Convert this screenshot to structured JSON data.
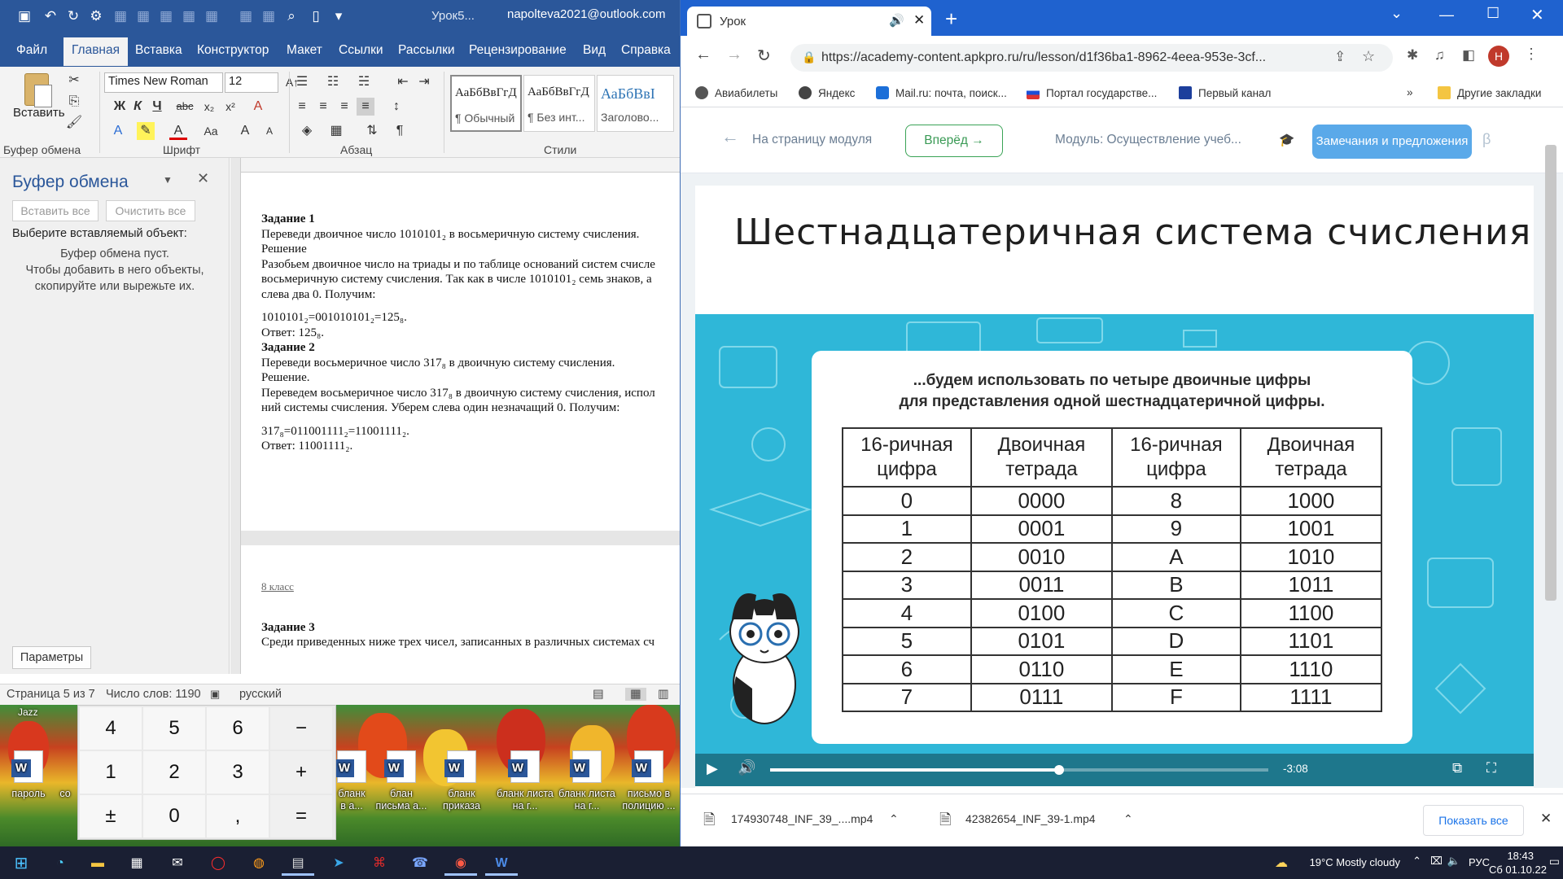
{
  "word": {
    "doc_title": "Урок5...",
    "account": "napolteva2021@outlook.com",
    "tabs": [
      "Файл",
      "Главная",
      "Вставка",
      "Конструктор",
      "Макет",
      "Ссылки",
      "Рассылки",
      "Рецензирование",
      "Вид",
      "Справка"
    ],
    "ribbon": {
      "paste_label": "Вставить",
      "font_name": "Times New Roman",
      "font_size": "12",
      "styles": [
        {
          "preview": "АаБбВвГгД",
          "name": "¶ Обычный"
        },
        {
          "preview": "АаБбВвГгД",
          "name": "¶ Без инт..."
        },
        {
          "preview": "АаБбВвІ",
          "name": "Заголово..."
        }
      ],
      "groups": [
        "Буфер обмена",
        "Шрифт",
        "Абзац",
        "Стили"
      ]
    },
    "clipboard": {
      "title": "Буфер обмена",
      "paste_all": "Вставить все",
      "clear_all": "Очистить все",
      "select_prompt": "Выберите вставляемый объект:",
      "empty_1": "Буфер обмена пуст.",
      "empty_2": "Чтобы добавить в него объекты,",
      "empty_3": "скопируйте или вырежьте их.",
      "params": "Параметры"
    },
    "document": {
      "p1": [
        "Задание 1",
        "Переведи двоичное число 1010101₂ в восьмеричную систему счисления.",
        "Решение",
        "Разобьем двоичное число на триады и по таблице оснований систем счисле",
        "восьмеричную систему счисления. Так как в числе 1010101₂ семь знаков, а",
        "слева два 0. Получим:",
        "",
        "1010101₂=001010101₂=125₈.",
        "Ответ: 125₈.",
        "Задание 2",
        "Переведи восьмеричное число 317₈ в двоичную систему счисления.",
        "Решение.",
        "Переведем восьмеричное число 317₈ в двоичную систему счисления, испол",
        "ний системы счисления. Уберем слева один незначащий 0. Получим:",
        "",
        "317₈=011001111₂=11001111₂.",
        "Ответ: 11001111₂."
      ],
      "p2_header": "8 класс",
      "p2_task": "Задание 3",
      "p2_line": "Среди приведенных ниже трех чисел, записанных в различных системах сч"
    },
    "status": {
      "page": "Страница 5 из 7",
      "words": "Число слов: 1190",
      "lang": "русский"
    }
  },
  "desktop": {
    "label_top": "Jazz",
    "icons": [
      "пароль",
      "со",
      "бланк в а...",
      "блан письма а...",
      "бланк приказа",
      "бланк листа на г...",
      "бланк листа на г...",
      "письмо в полицию ..."
    ]
  },
  "calculator": {
    "keys": [
      "4",
      "5",
      "6",
      "−",
      "1",
      "2",
      "3",
      "+",
      "±",
      "0",
      ",",
      "="
    ]
  },
  "chrome": {
    "tab_title": "Урок",
    "url": "https://academy-content.apkpro.ru/ru/lesson/d1f36ba1-8962-4eea-953e-3cf...",
    "profile_letter": "Н",
    "bookmarks": [
      "Авиабилеты",
      "Яндекс",
      "Mail.ru: почта, поиск...",
      "Портал государстве...",
      "Первый канал"
    ],
    "other_bookmarks": "Другие закладки",
    "page": {
      "back_to_module": "На страницу модуля",
      "forward": "Вперёд",
      "module": "Модуль: Осуществление учеб...",
      "remarks": "Замечания и предложения",
      "beta": "β",
      "lesson_title": "Шестнадцатеричная система счисления",
      "slide_caption_1": "...будем использовать по четыре двоичные цифры",
      "slide_caption_2": "для представления одной шестнадцатеричной цифры.",
      "table_headers": [
        "16-ричная цифра",
        "Двоичная тетрада",
        "16-ричная цифра",
        "Двоичная тетрада"
      ],
      "table_rows": [
        [
          "0",
          "0000",
          "8",
          "1000"
        ],
        [
          "1",
          "0001",
          "9",
          "1001"
        ],
        [
          "2",
          "0010",
          "A",
          "1010"
        ],
        [
          "3",
          "0011",
          "B",
          "1011"
        ],
        [
          "4",
          "0100",
          "C",
          "1100"
        ],
        [
          "5",
          "0101",
          "D",
          "1101"
        ],
        [
          "6",
          "0110",
          "E",
          "1110"
        ],
        [
          "7",
          "0111",
          "F",
          "1111"
        ]
      ],
      "time_remaining": "-3:08",
      "progress": 0.58
    },
    "downloads": [
      "174930748_INF_39_....mp4",
      "42382654_INF_39-1.mp4"
    ],
    "show_all": "Показать все"
  },
  "taskbar": {
    "weather": "19°C  Mostly cloudy",
    "lang": "РУС",
    "time": "18:43",
    "date": "Сб 01.10.22"
  },
  "colors": {
    "word_blue": "#2b579a",
    "chrome_blue": "#1f62cf",
    "video_bg": "#2fb7d8",
    "remarks_btn": "#5aa9e9"
  }
}
